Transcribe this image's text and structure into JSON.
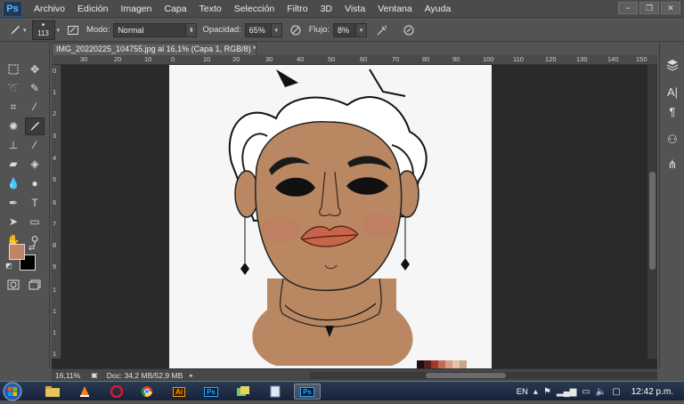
{
  "app": {
    "logo": "Ps"
  },
  "menu": [
    "Archivo",
    "Edición",
    "Imagen",
    "Capa",
    "Texto",
    "Selección",
    "Filtro",
    "3D",
    "Vista",
    "Ventana",
    "Ayuda"
  ],
  "window_buttons": [
    "−",
    "❐",
    "✕"
  ],
  "options": {
    "brush_size": "113",
    "mode_label": "Modo:",
    "mode_value": "Normal",
    "opacity_label": "Opacidad:",
    "opacity_value": "65%",
    "flow_label": "Flujo:",
    "flow_value": "8%"
  },
  "document": {
    "tab_title": "IMG_20220225_104755.jpg al 16,1% (Capa 1, RGB/8) *",
    "ruler_top": [
      "30",
      "20",
      "10",
      "0",
      "10",
      "20",
      "30",
      "40",
      "50",
      "60",
      "70",
      "80",
      "90",
      "100",
      "110",
      "120",
      "130",
      "140",
      "150"
    ],
    "ruler_left": [
      "0",
      "1",
      "2",
      "3",
      "4",
      "5",
      "6",
      "7",
      "8",
      "9",
      "1",
      "1",
      "1",
      "1",
      "1"
    ],
    "swatches": [
      "#1a0f0e",
      "#5a1e1a",
      "#a0392d",
      "#c06a57",
      "#d59f86",
      "#e3c2a8",
      "#c9a58f"
    ]
  },
  "status": {
    "zoom": "16,11%",
    "doc_size": "Doc: 34,2 MB/52,9 MB"
  },
  "colors": {
    "foreground": "#c08460",
    "background": "#000000",
    "skin": "#b98762",
    "lips": "#c8644a"
  },
  "tools": [
    "marquee-tool",
    "move-tool",
    "lasso-tool",
    "quick-selection-tool",
    "crop-tool",
    "eyedropper-tool",
    "spot-healing-tool",
    "brush-tool",
    "clone-stamp-tool",
    "history-brush-tool",
    "eraser-tool",
    "paint-bucket-tool",
    "blur-tool",
    "dodge-tool",
    "pen-tool",
    "type-tool",
    "path-selection-tool",
    "shape-tool",
    "hand-tool",
    "zoom-tool"
  ],
  "taskbar": {
    "apps": [
      "explorer-icon",
      "vlc-icon",
      "opera-icon",
      "chrome-icon",
      "illustrator-icon",
      "photoshop-icon",
      "files-icon",
      "notes-icon",
      "photoshop-active-icon"
    ],
    "ai_label": "Ai",
    "ps_label": "Ps",
    "language": "EN",
    "time": "12:42 p.m."
  }
}
